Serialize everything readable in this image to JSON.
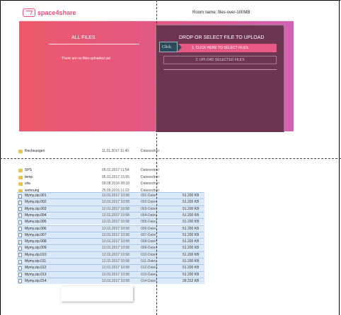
{
  "app": {
    "logo_text": "space4share",
    "room_label": "Room name: files-over-100MB",
    "all_files_title": "ALL FILES",
    "no_files_text": "There are no files uploaded yet",
    "upload_title": "DROP OR SELECT FILE TO UPLOAD",
    "select_button": "1. CLICK HERE TO SELECT FILES",
    "upload_button": "2. UPLOAD SELECTED FILES",
    "click_tag": "Click",
    "colors": {
      "accent": "#e85a86",
      "panel": "#6e3552"
    }
  },
  "explorer": {
    "rows": [
      {
        "name": "Rechnungen",
        "date": "11.01.2017 11:40",
        "type": "Dateiordner",
        "size": "",
        "kind": "folder",
        "selected": false
      },
      {
        "name": "SPS",
        "date": "05.01.2017 11:54",
        "type": "Dateiordner",
        "size": "",
        "kind": "folder",
        "selected": false
      },
      {
        "name": "temp",
        "date": "05.01.2017 15:55",
        "type": "Dateiordner",
        "size": "",
        "kind": "folder",
        "selected": false
      },
      {
        "name": "vita",
        "date": "09.08.2016 08:18",
        "type": "Dateiordner",
        "size": "",
        "kind": "folder",
        "selected": false
      },
      {
        "name": "wohnung",
        "date": "25.09.2016 11:23",
        "type": "Dateiordner",
        "size": "",
        "kind": "folder",
        "selected": false
      },
      {
        "name": "Mymy.zip.001",
        "date": "12.01.2017 10:58",
        "type": "001-Datei",
        "size": "51.200 KB",
        "kind": "file",
        "selected": true
      },
      {
        "name": "Mymy.zip.002",
        "date": "12.01.2017 10:58",
        "type": "002-Datei",
        "size": "51.200 KB",
        "kind": "file",
        "selected": true
      },
      {
        "name": "Mymy.zip.003",
        "date": "12.01.2017 10:58",
        "type": "003-Datei",
        "size": "51.200 KB",
        "kind": "file",
        "selected": true
      },
      {
        "name": "Mymy.zip.004",
        "date": "12.01.2017 10:58",
        "type": "004-Datei",
        "size": "51.200 KB",
        "kind": "file",
        "selected": true
      },
      {
        "name": "Mymy.zip.005",
        "date": "12.01.2017 10:58",
        "type": "005-Datei",
        "size": "51.200 KB",
        "kind": "file",
        "selected": true
      },
      {
        "name": "Mymy.zip.006",
        "date": "12.01.2017 10:58",
        "type": "006-Datei",
        "size": "51.200 KB",
        "kind": "file",
        "selected": true
      },
      {
        "name": "Mymy.zip.007",
        "date": "12.01.2017 10:58",
        "type": "007-Datei",
        "size": "51.200 KB",
        "kind": "file",
        "selected": true
      },
      {
        "name": "Mymy.zip.008",
        "date": "12.01.2017 10:58",
        "type": "008-Datei",
        "size": "51.200 KB",
        "kind": "file",
        "selected": true
      },
      {
        "name": "Mymy.zip.009",
        "date": "12.01.2017 10:58",
        "type": "009-Datei",
        "size": "51.200 KB",
        "kind": "file",
        "selected": true
      },
      {
        "name": "Mymy.zip.010",
        "date": "12.01.2017 10:58",
        "type": "010-Datei",
        "size": "51.200 KB",
        "kind": "file",
        "selected": true
      },
      {
        "name": "Mymy.zip.011",
        "date": "12.01.2017 10:58",
        "type": "011-Datei",
        "size": "51.200 KB",
        "kind": "file",
        "selected": true
      },
      {
        "name": "Mymy.zip.012",
        "date": "12.01.2017 10:58",
        "type": "012-Datei",
        "size": "51.200 KB",
        "kind": "file",
        "selected": true
      },
      {
        "name": "Mymy.zip.013",
        "date": "12.01.2017 10:58",
        "type": "013-Datei",
        "size": "51.200 KB",
        "kind": "file",
        "selected": true
      },
      {
        "name": "Mymy.zip.014",
        "date": "12.01.2017 10:58",
        "type": "014-Datei",
        "size": "28.312 KB",
        "kind": "file",
        "selected": true
      }
    ]
  }
}
